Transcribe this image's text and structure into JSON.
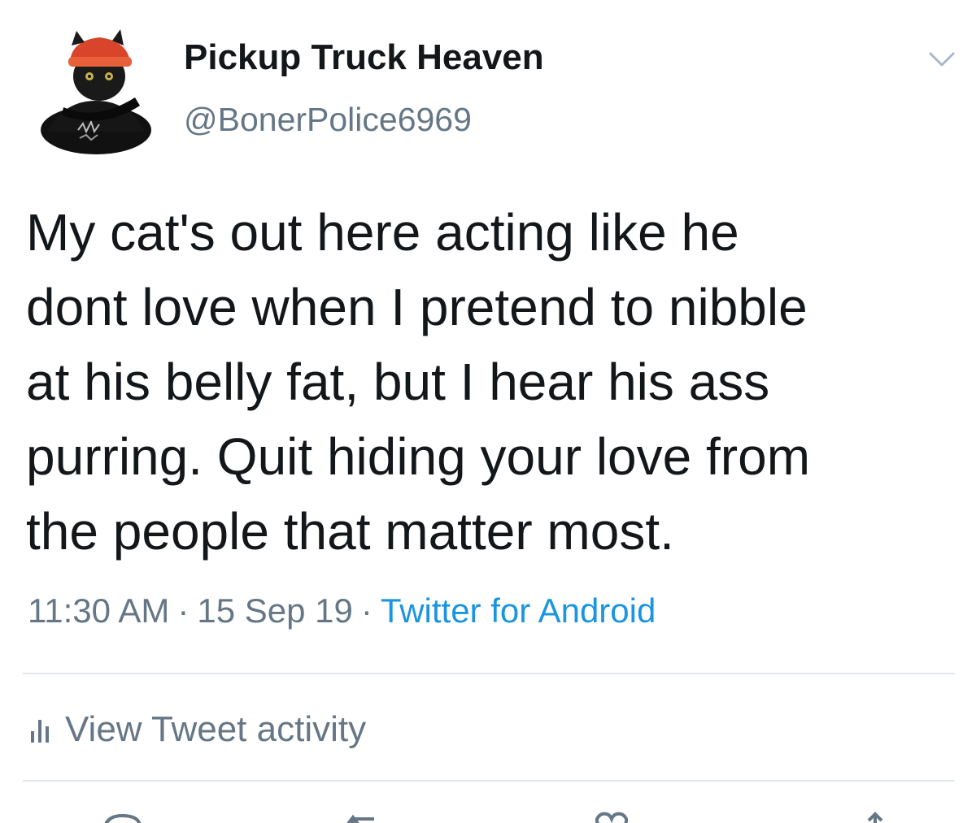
{
  "user": {
    "display_name": "Pickup Truck Heaven",
    "handle": "@BonerPolice6969",
    "avatar_icon": "cat-avatar-icon"
  },
  "tweet": {
    "text_lines": [
      "My cat's out here acting like he",
      "dont love when I pretend to nibble",
      "at his belly fat, but I hear his ass",
      "purring. Quit hiding your love from",
      "the people that matter most."
    ],
    "time": "11:30 AM",
    "date": "15 Sep 19",
    "separator": "·",
    "source": "Twitter for Android"
  },
  "activity": {
    "label": "View Tweet activity",
    "icon": "bar-chart-icon"
  },
  "menu": {
    "icon": "chevron-down-icon"
  },
  "actions": [
    {
      "name": "reply",
      "icon": "reply-icon"
    },
    {
      "name": "retweet",
      "icon": "retweet-icon"
    },
    {
      "name": "like",
      "icon": "heart-icon"
    },
    {
      "name": "share",
      "icon": "share-icon"
    }
  ],
  "colors": {
    "text": "#14171a",
    "secondary": "#657786",
    "link": "#1b95e0",
    "divider": "#e1e8ed"
  }
}
